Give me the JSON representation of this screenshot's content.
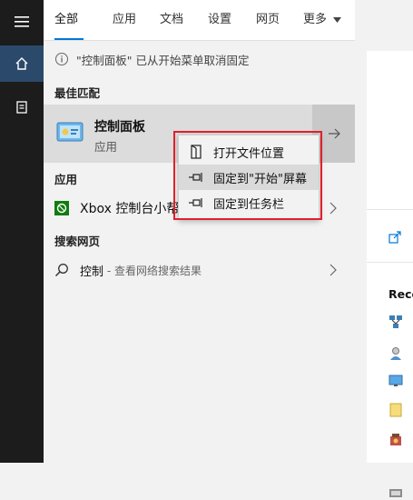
{
  "rail": {
    "items": [
      {
        "icon": "hamburger-menu-icon"
      },
      {
        "icon": "home-icon"
      },
      {
        "icon": "document-icon"
      }
    ]
  },
  "tabs": [
    {
      "label": "全部",
      "active": true
    },
    {
      "label": "应用"
    },
    {
      "label": "文档"
    },
    {
      "label": "设置"
    },
    {
      "label": "网页"
    },
    {
      "label": "更多"
    }
  ],
  "notice": {
    "icon": "info-icon",
    "text": "\"控制面板\" 已从开始菜单取消固定"
  },
  "best_match": {
    "section_title": "最佳匹配",
    "title": "控制面板",
    "subtitle": "应用",
    "icon": "control-panel-icon"
  },
  "apps": {
    "section_title": "应用",
    "items": [
      {
        "icon": "xbox-icon",
        "label": "Xbox 控制台小帮手"
      }
    ]
  },
  "web": {
    "section_title": "搜索网页",
    "items": [
      {
        "icon": "search-icon",
        "query": "控制",
        "suffix": " - 查看网络搜索结果"
      }
    ]
  },
  "context_menu": {
    "items": [
      {
        "icon": "open-file-location-icon",
        "label": "打开文件位置"
      },
      {
        "icon": "pin-icon",
        "label": "固定到\"开始\"屏幕",
        "hover": true
      },
      {
        "icon": "pin-icon",
        "label": "固定到任务栏"
      }
    ]
  },
  "right_panel": {
    "recent_label": "Rece"
  },
  "colors": {
    "accent": "#0078d7",
    "highlight_border": "#e0202a",
    "rail": "#1c1c1c"
  }
}
